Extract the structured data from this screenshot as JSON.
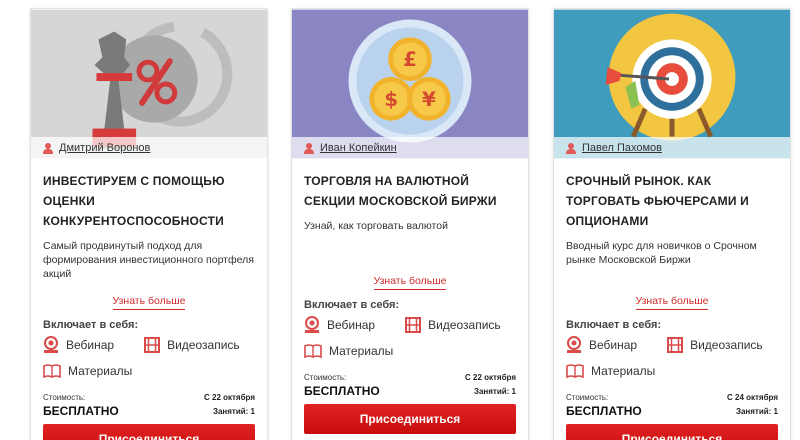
{
  "cards": [
    {
      "author": "Дмитрий Воронов",
      "title": "Инвестируем с помощью оценки конкурентоспособности",
      "description": "Самый продвинутый подход для формирования инвестиционного портфеля акций",
      "more_label": "Узнать больше",
      "includes_label": "Включает в себя:",
      "features": {
        "webinar": "Вебинар",
        "video": "Видеозапись",
        "materials": "Материалы"
      },
      "cost_label": "Стоимость:",
      "cost": "БЕСПЛАТНО",
      "start": "С 22 октября",
      "lessons": "Занятий: 1",
      "join_label": "Присоединиться",
      "hero_bg": "#d6d6d6",
      "hero_icons": [
        "chess-rook-icon",
        "percent-icon"
      ]
    },
    {
      "author": "Иван Копейкин",
      "title": "Торговля на валютной секции Московской биржи",
      "description": "Узнай, как торговать валютой",
      "more_label": "Узнать больше",
      "includes_label": "Включает в себя:",
      "features": {
        "webinar": "Вебинар",
        "video": "Видеозапись",
        "materials": "Материалы"
      },
      "cost_label": "Стоимость:",
      "cost": "БЕСПЛАТНО",
      "start": "С 22 октября",
      "lessons": "Занятий: 1",
      "join_label": "Присоединиться",
      "hero_bg": "#8a86c4",
      "hero_icons": [
        "pound-coin-icon",
        "dollar-coin-icon",
        "yen-coin-icon"
      ]
    },
    {
      "author": "Павел Пахомов",
      "title": "Срочный рынок. Как торговать фьючерсами и опционами",
      "description": "Вводный курс для новичков о Срочном рынке Московской Биржи",
      "more_label": "Узнать больше",
      "includes_label": "Включает в себя:",
      "features": {
        "webinar": "Вебинар",
        "video": "Видеозапись",
        "materials": "Материалы"
      },
      "cost_label": "Стоимость:",
      "cost": "БЕСПЛАТНО",
      "start": "С 24 октября",
      "lessons": "Занятий: 1",
      "join_label": "Присоединиться",
      "hero_bg": "#3f9cbd",
      "hero_icons": [
        "target-icon",
        "dart-icon"
      ]
    }
  ]
}
